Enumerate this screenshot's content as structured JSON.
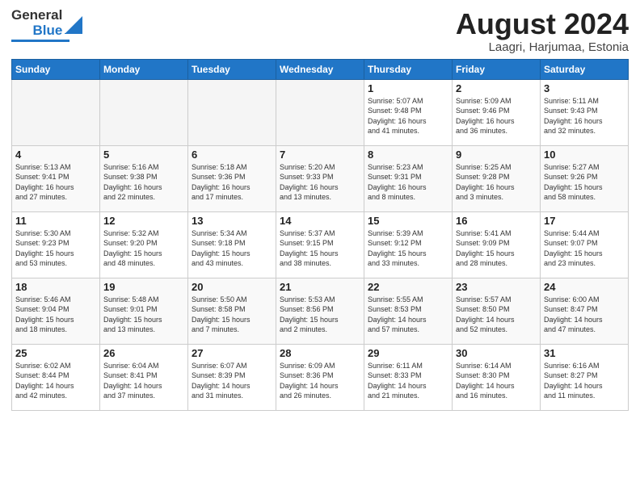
{
  "header": {
    "logo_general": "General",
    "logo_blue": "Blue",
    "title": "August 2024",
    "location": "Laagri, Harjumaa, Estonia"
  },
  "weekdays": [
    "Sunday",
    "Monday",
    "Tuesday",
    "Wednesday",
    "Thursday",
    "Friday",
    "Saturday"
  ],
  "weeks": [
    [
      {
        "day": "",
        "info": "",
        "empty": true
      },
      {
        "day": "",
        "info": "",
        "empty": true
      },
      {
        "day": "",
        "info": "",
        "empty": true
      },
      {
        "day": "",
        "info": "",
        "empty": true
      },
      {
        "day": "1",
        "info": "Sunrise: 5:07 AM\nSunset: 9:48 PM\nDaylight: 16 hours\nand 41 minutes.",
        "empty": false
      },
      {
        "day": "2",
        "info": "Sunrise: 5:09 AM\nSunset: 9:46 PM\nDaylight: 16 hours\nand 36 minutes.",
        "empty": false
      },
      {
        "day": "3",
        "info": "Sunrise: 5:11 AM\nSunset: 9:43 PM\nDaylight: 16 hours\nand 32 minutes.",
        "empty": false
      }
    ],
    [
      {
        "day": "4",
        "info": "Sunrise: 5:13 AM\nSunset: 9:41 PM\nDaylight: 16 hours\nand 27 minutes.",
        "empty": false
      },
      {
        "day": "5",
        "info": "Sunrise: 5:16 AM\nSunset: 9:38 PM\nDaylight: 16 hours\nand 22 minutes.",
        "empty": false
      },
      {
        "day": "6",
        "info": "Sunrise: 5:18 AM\nSunset: 9:36 PM\nDaylight: 16 hours\nand 17 minutes.",
        "empty": false
      },
      {
        "day": "7",
        "info": "Sunrise: 5:20 AM\nSunset: 9:33 PM\nDaylight: 16 hours\nand 13 minutes.",
        "empty": false
      },
      {
        "day": "8",
        "info": "Sunrise: 5:23 AM\nSunset: 9:31 PM\nDaylight: 16 hours\nand 8 minutes.",
        "empty": false
      },
      {
        "day": "9",
        "info": "Sunrise: 5:25 AM\nSunset: 9:28 PM\nDaylight: 16 hours\nand 3 minutes.",
        "empty": false
      },
      {
        "day": "10",
        "info": "Sunrise: 5:27 AM\nSunset: 9:26 PM\nDaylight: 15 hours\nand 58 minutes.",
        "empty": false
      }
    ],
    [
      {
        "day": "11",
        "info": "Sunrise: 5:30 AM\nSunset: 9:23 PM\nDaylight: 15 hours\nand 53 minutes.",
        "empty": false
      },
      {
        "day": "12",
        "info": "Sunrise: 5:32 AM\nSunset: 9:20 PM\nDaylight: 15 hours\nand 48 minutes.",
        "empty": false
      },
      {
        "day": "13",
        "info": "Sunrise: 5:34 AM\nSunset: 9:18 PM\nDaylight: 15 hours\nand 43 minutes.",
        "empty": false
      },
      {
        "day": "14",
        "info": "Sunrise: 5:37 AM\nSunset: 9:15 PM\nDaylight: 15 hours\nand 38 minutes.",
        "empty": false
      },
      {
        "day": "15",
        "info": "Sunrise: 5:39 AM\nSunset: 9:12 PM\nDaylight: 15 hours\nand 33 minutes.",
        "empty": false
      },
      {
        "day": "16",
        "info": "Sunrise: 5:41 AM\nSunset: 9:09 PM\nDaylight: 15 hours\nand 28 minutes.",
        "empty": false
      },
      {
        "day": "17",
        "info": "Sunrise: 5:44 AM\nSunset: 9:07 PM\nDaylight: 15 hours\nand 23 minutes.",
        "empty": false
      }
    ],
    [
      {
        "day": "18",
        "info": "Sunrise: 5:46 AM\nSunset: 9:04 PM\nDaylight: 15 hours\nand 18 minutes.",
        "empty": false
      },
      {
        "day": "19",
        "info": "Sunrise: 5:48 AM\nSunset: 9:01 PM\nDaylight: 15 hours\nand 13 minutes.",
        "empty": false
      },
      {
        "day": "20",
        "info": "Sunrise: 5:50 AM\nSunset: 8:58 PM\nDaylight: 15 hours\nand 7 minutes.",
        "empty": false
      },
      {
        "day": "21",
        "info": "Sunrise: 5:53 AM\nSunset: 8:56 PM\nDaylight: 15 hours\nand 2 minutes.",
        "empty": false
      },
      {
        "day": "22",
        "info": "Sunrise: 5:55 AM\nSunset: 8:53 PM\nDaylight: 14 hours\nand 57 minutes.",
        "empty": false
      },
      {
        "day": "23",
        "info": "Sunrise: 5:57 AM\nSunset: 8:50 PM\nDaylight: 14 hours\nand 52 minutes.",
        "empty": false
      },
      {
        "day": "24",
        "info": "Sunrise: 6:00 AM\nSunset: 8:47 PM\nDaylight: 14 hours\nand 47 minutes.",
        "empty": false
      }
    ],
    [
      {
        "day": "25",
        "info": "Sunrise: 6:02 AM\nSunset: 8:44 PM\nDaylight: 14 hours\nand 42 minutes.",
        "empty": false
      },
      {
        "day": "26",
        "info": "Sunrise: 6:04 AM\nSunset: 8:41 PM\nDaylight: 14 hours\nand 37 minutes.",
        "empty": false
      },
      {
        "day": "27",
        "info": "Sunrise: 6:07 AM\nSunset: 8:39 PM\nDaylight: 14 hours\nand 31 minutes.",
        "empty": false
      },
      {
        "day": "28",
        "info": "Sunrise: 6:09 AM\nSunset: 8:36 PM\nDaylight: 14 hours\nand 26 minutes.",
        "empty": false
      },
      {
        "day": "29",
        "info": "Sunrise: 6:11 AM\nSunset: 8:33 PM\nDaylight: 14 hours\nand 21 minutes.",
        "empty": false
      },
      {
        "day": "30",
        "info": "Sunrise: 6:14 AM\nSunset: 8:30 PM\nDaylight: 14 hours\nand 16 minutes.",
        "empty": false
      },
      {
        "day": "31",
        "info": "Sunrise: 6:16 AM\nSunset: 8:27 PM\nDaylight: 14 hours\nand 11 minutes.",
        "empty": false
      }
    ]
  ]
}
